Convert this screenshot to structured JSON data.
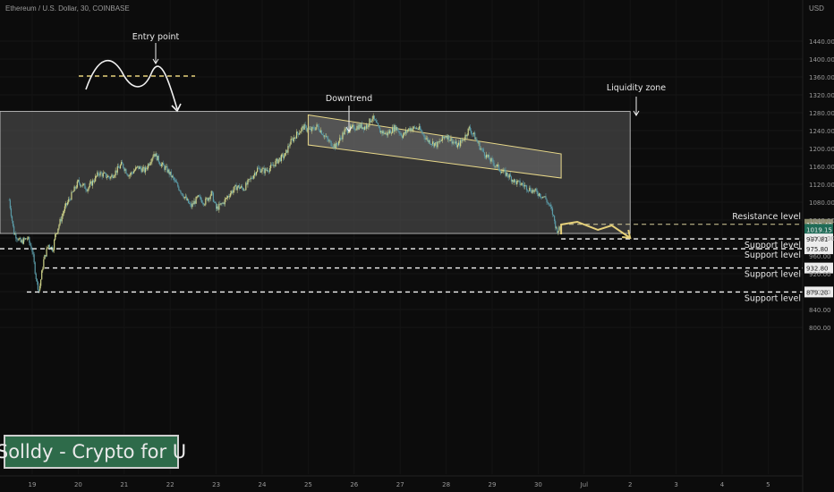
{
  "ticker_label": "Ethereum / U.S. Dollar, 30, COINBASE",
  "currency_label": "USD",
  "watermark": "Solldy - Crypto for U",
  "colors": {
    "background": "#0c0c0c",
    "candle": "#5a9aa6",
    "candle_alt": "#cfd48a",
    "zone_fill": "#5a5a5a",
    "channel_fill": "#7a7a7a",
    "channel_border": "#e9d98a",
    "projection": "#e5d07a",
    "level_line": "#f3f3f3",
    "resistance_line": "#d8cf9c"
  },
  "chart_data": {
    "type": "candlestick",
    "title": "Ethereum / U.S. Dollar, 30, COINBASE",
    "ylabel": "USD",
    "ylim": [
      760,
      1480
    ],
    "y_ticks": [
      800,
      840,
      880,
      920,
      960,
      1000,
      1040,
      1080,
      1120,
      1160,
      1200,
      1240,
      1280,
      1320,
      1360,
      1400,
      1440
    ],
    "x_ticks": [
      "19",
      "20",
      "21",
      "22",
      "23",
      "24",
      "25",
      "26",
      "27",
      "28",
      "29",
      "30",
      "Jul",
      "2",
      "3",
      "4",
      "5"
    ],
    "price_path": [
      [
        18.5,
        1085
      ],
      [
        18.6,
        1012
      ],
      [
        18.75,
        990
      ],
      [
        18.9,
        1000
      ],
      [
        19.0,
        972
      ],
      [
        19.1,
        900
      ],
      [
        19.15,
        882
      ],
      [
        19.25,
        950
      ],
      [
        19.35,
        985
      ],
      [
        19.45,
        975
      ],
      [
        19.5,
        1005
      ],
      [
        19.7,
        1065
      ],
      [
        19.85,
        1095
      ],
      [
        20.0,
        1125
      ],
      [
        20.2,
        1110
      ],
      [
        20.45,
        1145
      ],
      [
        20.7,
        1135
      ],
      [
        20.95,
        1165
      ],
      [
        21.1,
        1140
      ],
      [
        21.3,
        1158
      ],
      [
        21.45,
        1150
      ],
      [
        21.65,
        1190
      ],
      [
        21.8,
        1165
      ],
      [
        21.95,
        1150
      ],
      [
        22.2,
        1110
      ],
      [
        22.35,
        1085
      ],
      [
        22.45,
        1070
      ],
      [
        22.6,
        1090
      ],
      [
        22.75,
        1080
      ],
      [
        22.9,
        1100
      ],
      [
        23.0,
        1065
      ],
      [
        23.15,
        1078
      ],
      [
        23.3,
        1100
      ],
      [
        23.45,
        1115
      ],
      [
        23.6,
        1110
      ],
      [
        23.75,
        1132
      ],
      [
        23.9,
        1155
      ],
      [
        24.05,
        1150
      ],
      [
        24.2,
        1158
      ],
      [
        24.35,
        1175
      ],
      [
        24.5,
        1185
      ],
      [
        24.6,
        1212
      ],
      [
        24.75,
        1232
      ],
      [
        24.9,
        1248
      ],
      [
        25.05,
        1240
      ],
      [
        25.2,
        1250
      ],
      [
        25.3,
        1236
      ],
      [
        25.45,
        1215
      ],
      [
        25.6,
        1205
      ],
      [
        25.8,
        1240
      ],
      [
        25.95,
        1245
      ],
      [
        26.1,
        1250
      ],
      [
        26.25,
        1248
      ],
      [
        26.4,
        1270
      ],
      [
        26.55,
        1240
      ],
      [
        26.7,
        1232
      ],
      [
        26.9,
        1248
      ],
      [
        27.05,
        1228
      ],
      [
        27.2,
        1245
      ],
      [
        27.4,
        1245
      ],
      [
        27.6,
        1218
      ],
      [
        27.8,
        1208
      ],
      [
        28.0,
        1230
      ],
      [
        28.1,
        1220
      ],
      [
        28.25,
        1205
      ],
      [
        28.4,
        1225
      ],
      [
        28.5,
        1245
      ],
      [
        28.6,
        1230
      ],
      [
        28.75,
        1200
      ],
      [
        28.9,
        1180
      ],
      [
        29.05,
        1165
      ],
      [
        29.2,
        1150
      ],
      [
        29.35,
        1140
      ],
      [
        29.5,
        1125
      ],
      [
        29.65,
        1120
      ],
      [
        29.8,
        1110
      ],
      [
        30.0,
        1100
      ],
      [
        30.15,
        1090
      ],
      [
        30.3,
        1060
      ],
      [
        30.4,
        1018
      ],
      [
        30.5,
        1020
      ]
    ],
    "annotations": {
      "entry_point_label": "Entry point",
      "downtrend_label": "Downtrend",
      "liquidity_zone_label": "Liquidity zone"
    },
    "levels": [
      {
        "label": "Resistance level",
        "tag": "1030.48",
        "value": 1030.48,
        "kind": "resistance"
      },
      {
        "label": "",
        "tag": "1019.15",
        "value": 1019.15,
        "kind": "current"
      },
      {
        "label": "Support level",
        "tag": "997.81",
        "value": 997.81,
        "kind": "support"
      },
      {
        "label": "Support level",
        "tag": "975.80",
        "value": 975.8,
        "kind": "support"
      },
      {
        "label": "Support level",
        "tag": "932.80",
        "value": 932.8,
        "kind": "support"
      },
      {
        "label": "Support level",
        "tag": "879.20",
        "value": 879.2,
        "kind": "support"
      }
    ],
    "liquidity_zone": {
      "x_start": 18.3,
      "x_end": 32.0,
      "y_low": 1010,
      "y_high": 1283
    },
    "downtrend_channel": {
      "upper": [
        [
          25.0,
          1275
        ],
        [
          30.5,
          1188
        ]
      ],
      "lower": [
        [
          25.0,
          1208
        ],
        [
          30.5,
          1134
        ]
      ]
    },
    "projection_path": [
      [
        30.5,
        1008
      ],
      [
        30.5,
        1030
      ],
      [
        30.85,
        1036
      ],
      [
        31.3,
        1018
      ],
      [
        31.6,
        1028
      ],
      [
        32.0,
        1000
      ]
    ],
    "entry_sketch_level": 1362
  }
}
